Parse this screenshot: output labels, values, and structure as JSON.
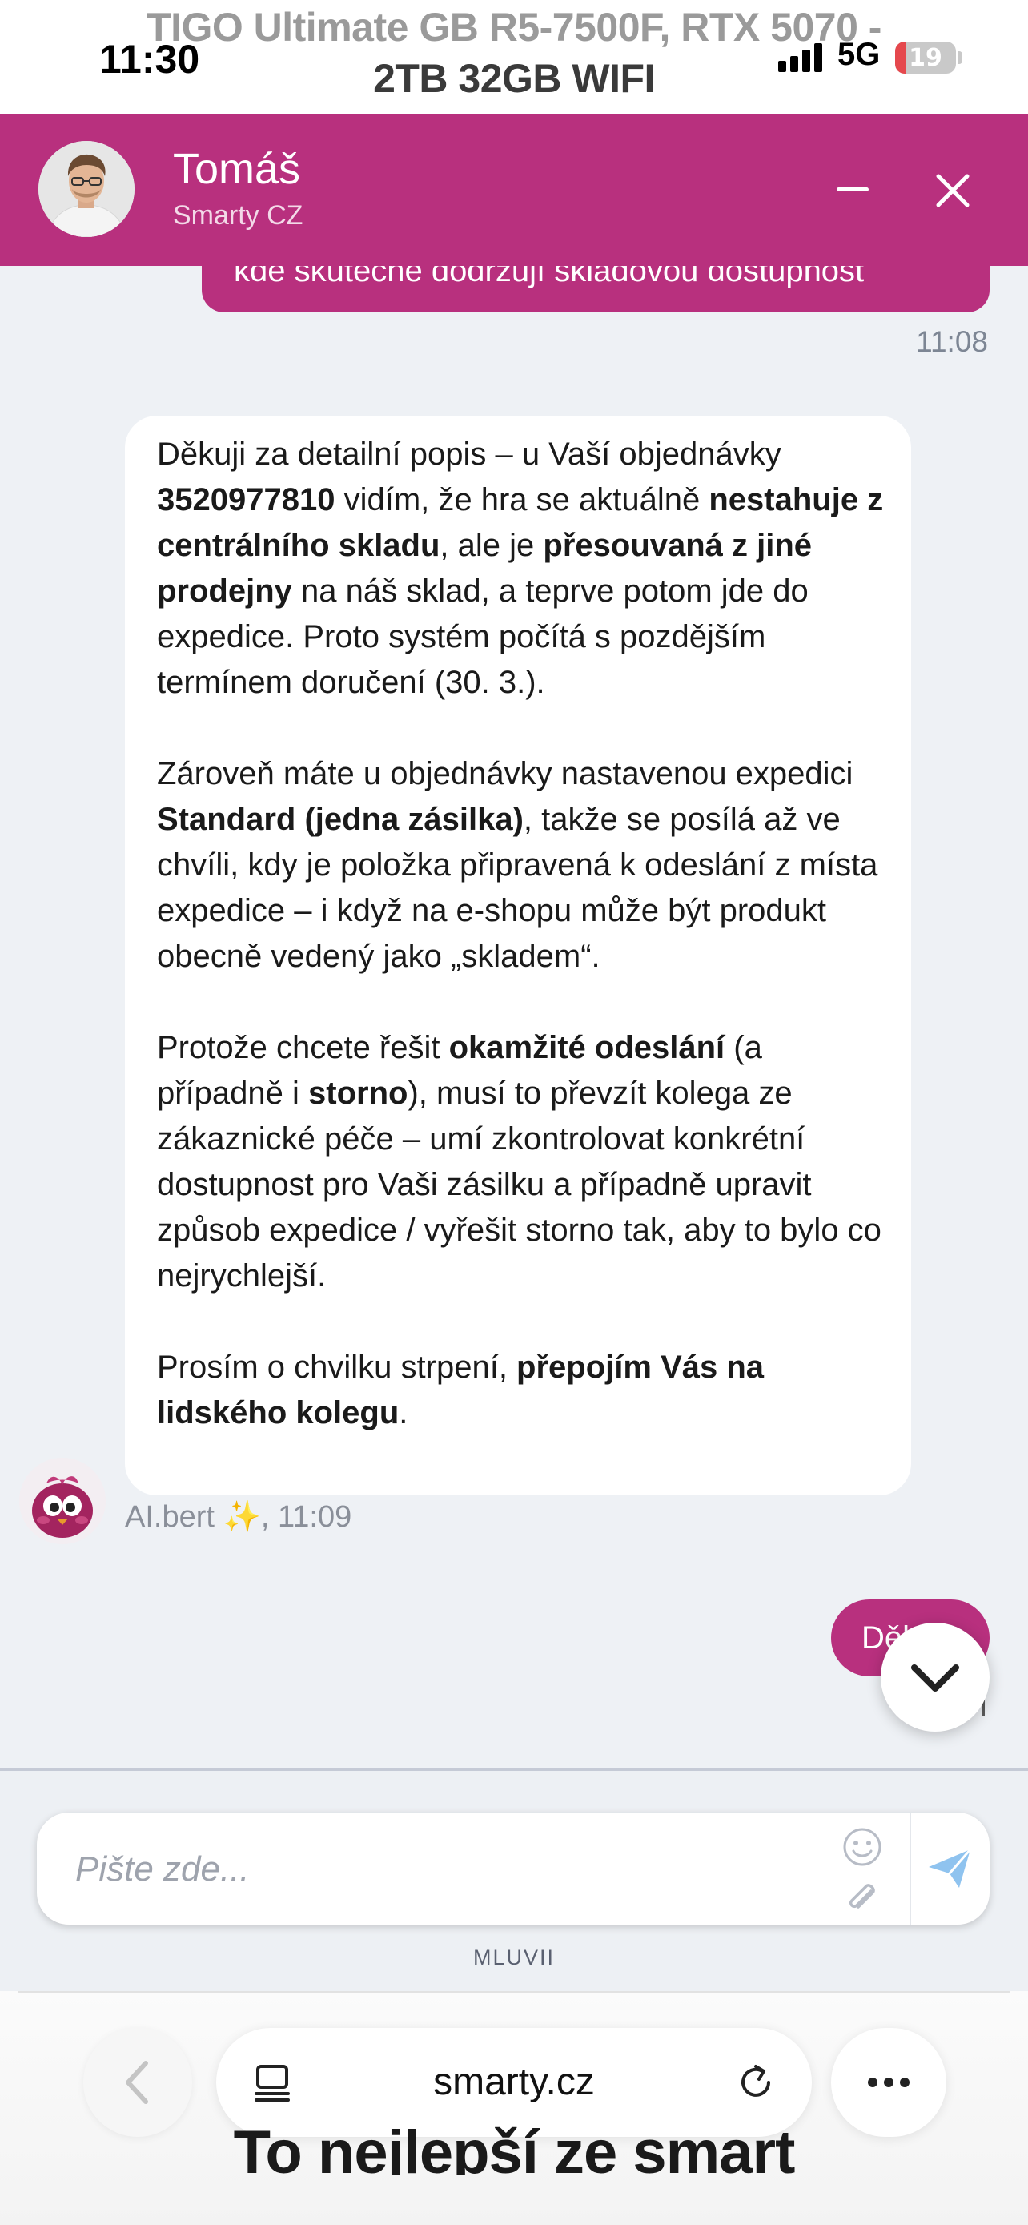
{
  "status_bar": {
    "time": "11:30",
    "network": "5G",
    "battery": "19",
    "battery_level": 0.19
  },
  "page": {
    "title_line1": "TIGO Ultimate GB R5-7500F, RTX 5070 -",
    "title_line2": "2TB 32GB WIFI",
    "bottom_banner": "To nejlepší ze smart"
  },
  "chat_header": {
    "agent_name": "Tomáš",
    "agent_company": "Smarty CZ",
    "minimize_icon": "minus-icon",
    "close_icon": "close-icon"
  },
  "messages": {
    "user_top": {
      "text": "kde skutečně dodržují skladovou dostupnost",
      "time": "11:08"
    },
    "bot": {
      "p1": {
        "a": "Děkuji za detailní popis – u Vaší objednávky ",
        "b": "3520977810",
        "c": " vidím, že hra se aktuálně ",
        "d": "nestahuje z centrálního skladu",
        "e": ", ale je ",
        "f": "přesouvaná z jiné prodejny",
        "g": " na náš sklad, a teprve potom jde do expedice. Proto systém počítá s pozdějším termínem doručení (30. 3.)."
      },
      "p2": {
        "a": "Zároveň máte u objednávky nastavenou expedici ",
        "b": "Standard (jedna zásilka)",
        "c": ", takže se posílá až ve chvíli, kdy je položka připravená k odeslání z místa expedice – i když na e-shopu může být produkt obecně vedený jako „skladem“."
      },
      "p3": {
        "a": "Protože chcete řešit ",
        "b": "okamžité odeslání",
        "c": " (a případně i ",
        "d": "storno",
        "e": "), musí to převzít kolega ze zákaznické péče – umí zkontrolovat konkrétní dostupnost pro Vaši zásilku a případně upravit způsob expedice / vyřešit storno tak, aby to bylo co nejrychlejší."
      },
      "p4": {
        "a": "Prosím o chvilku strpení, ",
        "b": "přepojím Vás na lidského kolegu",
        "c": "."
      },
      "sender": "AI.bert",
      "sparkle": "✨",
      "time": ", 11:09"
    },
    "user_bottom": {
      "text": "Děkuji"
    }
  },
  "composer": {
    "placeholder": "Pište zde...",
    "powered_by": "MLUVII",
    "emoji_icon": "emoji-icon",
    "attach_icon": "paperclip-icon",
    "send_icon": "send-icon"
  },
  "browser": {
    "url": "smarty.cz",
    "back_icon": "chevron-left-icon",
    "tabs_icon": "tabs-icon",
    "reload_icon": "reload-icon",
    "more_icon": "more-icon"
  },
  "colors": {
    "brand": "#b8307e",
    "background": "#eef1f5",
    "send_icon": "#8fc3ef"
  }
}
